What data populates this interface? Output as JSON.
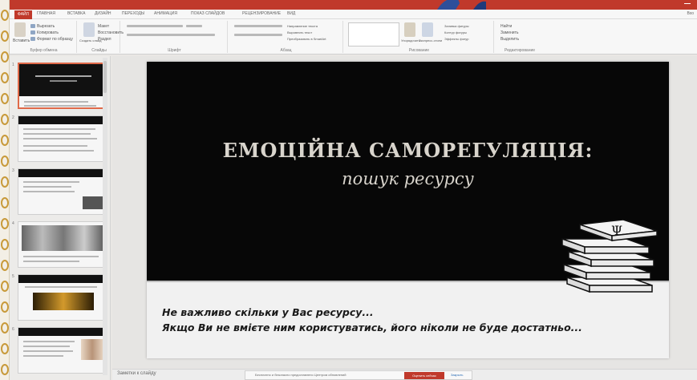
{
  "window": {
    "title": "",
    "accent": "#c0392b"
  },
  "ribbon": {
    "tabs": [
      "ФАЙЛ",
      "ГЛАВНАЯ",
      "ВСТАВКА",
      "ДИЗАЙН",
      "ПЕРЕХОДЫ",
      "АНИМАЦИЯ",
      "ПОКАЗ СЛАЙДОВ",
      "РЕЦЕНЗИРОВАНИЕ",
      "ВИД"
    ],
    "active_tab": "ГЛАВНАЯ",
    "right_label": "Вхо",
    "groups": [
      "Буфер обмена",
      "Слайды",
      "Шрифт",
      "Абзац",
      "Рисование",
      "Редактирование"
    ],
    "buttons": {
      "paste": "Вставить",
      "cut": "Вырезать",
      "copy": "Копировать",
      "format_painter": "Формат по образцу",
      "new_slide": "Создать слайд",
      "layout": "Макет",
      "reset": "Восстановить",
      "section": "Раздел",
      "text_direction": "Направление текста",
      "align_text": "Выровнять текст",
      "smartart": "Преобразовать в SmartArt",
      "arrange": "Упорядочить",
      "quick_styles": "Экспресс-стили",
      "shape_fill": "Заливка фигуры",
      "shape_outline": "Контур фигуры",
      "shape_effects": "Эффекты фигур",
      "find": "Найти",
      "replace": "Заменить",
      "select": "Выделить"
    }
  },
  "slide": {
    "title": "ЕМОЦІЙНА САМОРЕГУЛЯЦІЯ:",
    "subtitle": "пошук ресурсу",
    "quote_line1": "Не важливо скільки у Вас ресурсу...",
    "quote_line2": "Якщо Ви не вмієте ним користуватись, його ніколи не буде достатньо...",
    "books_symbol": "Ψ",
    "colors": {
      "background": "#070707",
      "title": "#d8d4cc",
      "band": "#f1f1f1"
    }
  },
  "thumbnails": {
    "numbers": [
      "1",
      "2",
      "3",
      "4",
      "5",
      "6"
    ],
    "selected": 1
  },
  "status": {
    "slide_counter": "Заметки к слайду"
  },
  "notice": {
    "text": "Бесплатно и безопасно предоставлено Центром обновлений",
    "button": "Оценить сейчас",
    "close": "Закрыть"
  }
}
